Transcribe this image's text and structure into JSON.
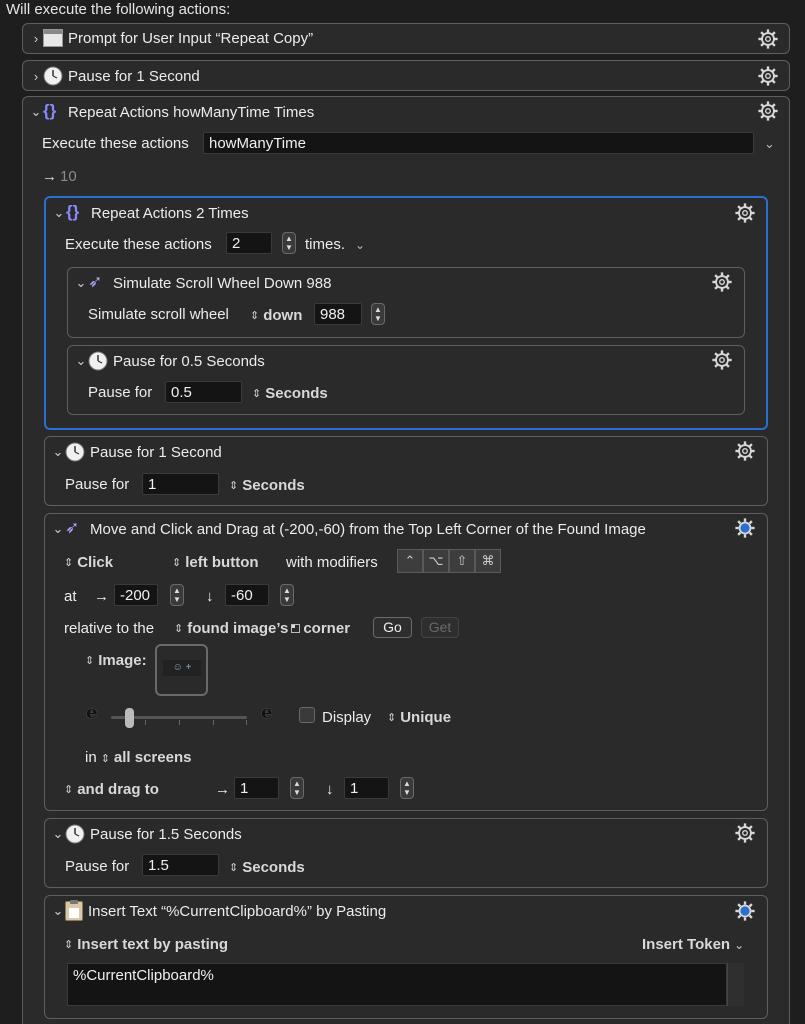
{
  "header": {
    "title": "Will execute the following actions:"
  },
  "actions": {
    "prompt": {
      "title": "Prompt for User Input “Repeat Copy”"
    },
    "pause1": {
      "title": "Pause for 1 Second"
    },
    "repeat_outer": {
      "title": "Repeat Actions howManyTime Times",
      "execute_label": "Execute these actions",
      "execute_value": "howManyTime",
      "result_arrow": "→",
      "result_value": "10"
    },
    "repeat_inner": {
      "title": "Repeat Actions 2 Times",
      "execute_label": "Execute these actions",
      "count_value": "2",
      "times_label": "times."
    },
    "scroll": {
      "title": "Simulate Scroll Wheel Down 988",
      "label": "Simulate scroll wheel",
      "direction": "down",
      "amount": "988"
    },
    "pause05": {
      "title": "Pause for 0.5 Seconds",
      "label": "Pause for",
      "value": "0.5",
      "unit": "Seconds"
    },
    "pause1b": {
      "title": "Pause for 1 Second",
      "label": "Pause for",
      "value": "1",
      "unit": "Seconds"
    },
    "move_click": {
      "title": "Move and Click and Drag at (-200,-60) from the Top Left Corner of the Found Image",
      "click_label": "Click",
      "button_label": "left button",
      "modifiers_label": "with modifiers",
      "modifiers": [
        "⌃",
        "⌥",
        "⇧",
        "⌘"
      ],
      "at_label": "at",
      "x_arrow": "→",
      "x_value": "-200",
      "y_arrow": "↓",
      "y_value": "-60",
      "relative_label": "relative to the",
      "relative_value": "found image’s",
      "corner_label": "corner",
      "go_label": "Go",
      "get_label": "Get",
      "image_label": "Image:",
      "image_placeholder": "☺ +",
      "fuzz_left": "e",
      "fuzz_right": "e",
      "display_label": "Display",
      "unique_label": "Unique",
      "in_label": "in",
      "screens_label": "all screens",
      "drag_label": "and drag to",
      "drag_x_arrow": "→",
      "drag_x": "1",
      "drag_y_arrow": "↓",
      "drag_y": "1"
    },
    "pause15": {
      "title": "Pause for 1.5 Seconds",
      "label": "Pause for",
      "value": "1.5",
      "unit": "Seconds"
    },
    "insert_text": {
      "title": "Insert Text “%CurrentClipboard%” by Pasting",
      "mode_label": "Insert text by pasting",
      "token_label": "Insert Token",
      "text_value": "%CurrentClipboard%"
    }
  },
  "colors": {
    "accent": "#2a6fd0",
    "card_bg": "#2a2a2a",
    "page_bg": "#1e1e1e",
    "gear_active": "#2a6fd0"
  }
}
